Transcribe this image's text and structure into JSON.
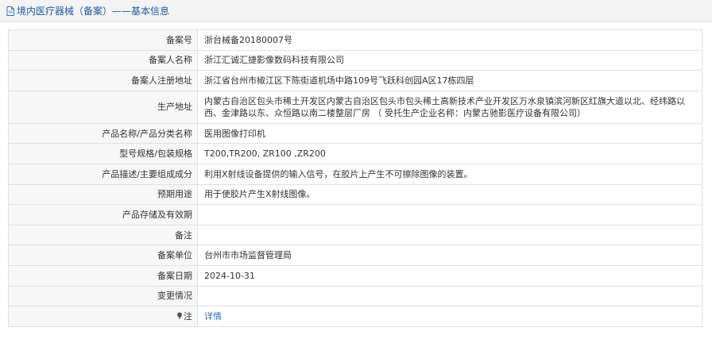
{
  "header": {
    "title": "境内医疗器械（备案）——基本信息"
  },
  "rows": [
    {
      "label": "备案号",
      "value": "浙台械备20180007号"
    },
    {
      "label": "备案人名称",
      "value": "浙江汇诚汇捷影像数码科技有限公司"
    },
    {
      "label": "备案人注册地址",
      "value": "浙江省台州市椒江区下陈街道机场中路109号飞跃科创园A区17栋四层"
    },
    {
      "label": "生产地址",
      "value": "内蒙古自治区包头市稀土开发区内蒙古自治区包头市包头稀土高新技术产业开发区万水泉镇滨河新区红旗大道以北、经纬路以西、金津路以东、众恒路以南二楼整层厂房 （ 受托生产企业名称：内蒙古驰影医疗设备有限公司）"
    },
    {
      "label": "产品名称/产品分类名称",
      "value": "医用图像打印机"
    },
    {
      "label": "型号规格/包装规格",
      "value": "T200,TR200, ZR100 ,ZR200"
    },
    {
      "label": "产品描述/主要组成成分",
      "value": "利用X射线设备提供的输入信号，在胶片上产生不可擦除图像的装置。"
    },
    {
      "label": "预期用途",
      "value": "用于使胶片产生X射线图像。"
    },
    {
      "label": "产品存储及有效期",
      "value": ""
    },
    {
      "label": "备注",
      "value": ""
    },
    {
      "label": "备案单位",
      "value": "台州市市场监督管理局"
    },
    {
      "label": "备案日期",
      "value": "2024-10-31"
    },
    {
      "label": "变更情况",
      "value": ""
    }
  ],
  "note_row": {
    "label": "注",
    "link_text": "详情",
    "icon": "pin-icon"
  }
}
